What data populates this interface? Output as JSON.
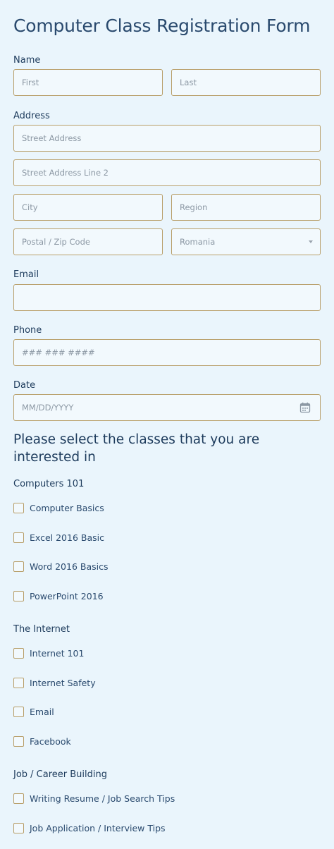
{
  "form": {
    "title": "Computer Class Registration Form"
  },
  "name": {
    "label": "Name",
    "first_placeholder": "First",
    "last_placeholder": "Last"
  },
  "address": {
    "label": "Address",
    "street_placeholder": "Street Address",
    "street2_placeholder": "Street Address Line 2",
    "city_placeholder": "City",
    "region_placeholder": "Region",
    "postal_placeholder": "Postal / Zip Code",
    "country_selected": "Romania"
  },
  "email": {
    "label": "Email",
    "value": ""
  },
  "phone": {
    "label": "Phone",
    "placeholder": "### ### ####"
  },
  "date": {
    "label": "Date",
    "placeholder": "MM/DD/YYYY",
    "icon": "calendar-icon"
  },
  "classes": {
    "heading": "Please select the classes that you are interested in",
    "groups": [
      {
        "label": "Computers 101",
        "options": [
          "Computer Basics",
          "Excel 2016 Basic",
          "Word 2016 Basics",
          "PowerPoint 2016"
        ]
      },
      {
        "label": "The Internet",
        "options": [
          "Internet 101",
          "Internet Safety",
          "Email",
          "Facebook"
        ]
      },
      {
        "label": "Job / Career Building",
        "options": [
          "Writing Resume / Job Search Tips",
          "Job Application / Interview Tips"
        ]
      }
    ]
  },
  "colors": {
    "background": "#eaf5fc",
    "field_border": "#b89f6a",
    "text": "#1d3b5c"
  }
}
